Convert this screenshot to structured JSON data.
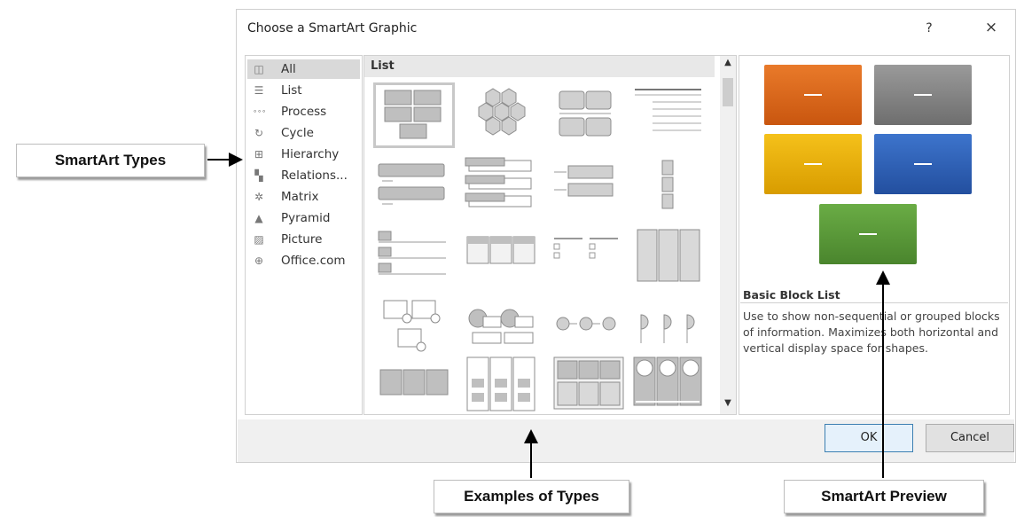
{
  "dialog": {
    "title": "Choose a SmartArt Graphic",
    "help_label": "?",
    "close_label": "×"
  },
  "types": [
    {
      "label": "All",
      "icon": "all-icon",
      "glyph": "◫",
      "selected": true
    },
    {
      "label": "List",
      "icon": "list-icon",
      "glyph": "☰"
    },
    {
      "label": "Process",
      "icon": "process-icon",
      "glyph": "∘∘∘"
    },
    {
      "label": "Cycle",
      "icon": "cycle-icon",
      "glyph": "↻"
    },
    {
      "label": "Hierarchy",
      "icon": "hierarchy-icon",
      "glyph": "⊞"
    },
    {
      "label": "Relations...",
      "icon": "relationship-icon",
      "glyph": "▚"
    },
    {
      "label": "Matrix",
      "icon": "matrix-icon",
      "glyph": "✲"
    },
    {
      "label": "Pyramid",
      "icon": "pyramid-icon",
      "glyph": "▲"
    },
    {
      "label": "Picture",
      "icon": "picture-icon",
      "glyph": "▨"
    },
    {
      "label": "Office.com",
      "icon": "globe-icon",
      "glyph": "⊕"
    }
  ],
  "examples": {
    "header": "List",
    "scroll_up": "▲",
    "scroll_down": "▼"
  },
  "preview": {
    "title": "Basic Block List",
    "description": "Use to show non-sequential or grouped blocks of information. Maximizes both horizontal and vertical display space for shapes.",
    "colors": {
      "orange": "#e06a1e",
      "gray": "#808080",
      "yellow": "#f0b400",
      "blue": "#2f62b8",
      "green": "#5a9a38"
    }
  },
  "buttons": {
    "ok": "OK",
    "cancel": "Cancel"
  },
  "callouts": {
    "types": "SmartArt Types",
    "examples": "Examples of Types",
    "preview": "SmartArt Preview"
  }
}
